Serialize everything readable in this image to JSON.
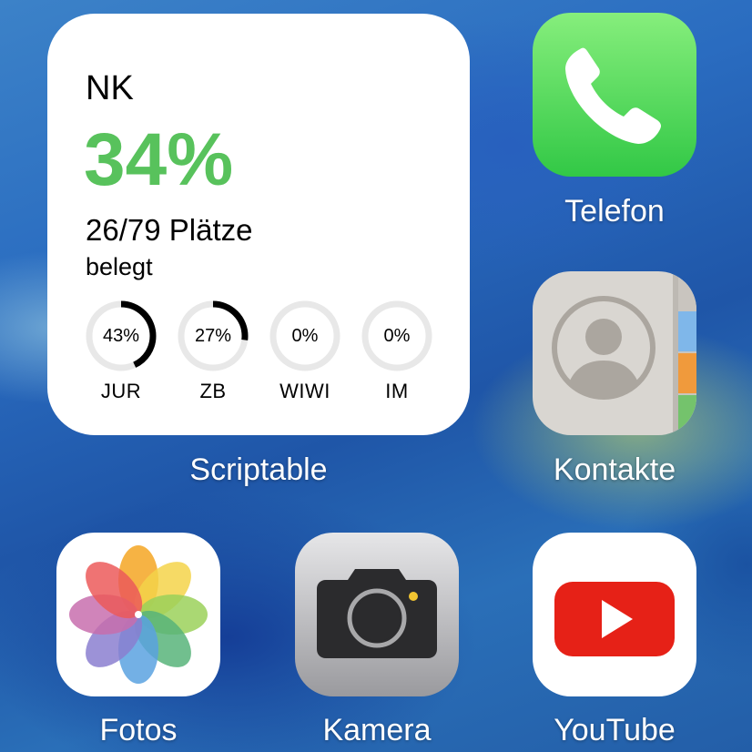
{
  "widget": {
    "title": "NK",
    "percent": "34%",
    "count": "26/79 Plätze",
    "status": "belegt",
    "accent_color": "#58c25c",
    "rings": [
      {
        "value": "43%",
        "fraction": 0.43,
        "label": "JUR"
      },
      {
        "value": "27%",
        "fraction": 0.27,
        "label": "ZB"
      },
      {
        "value": "0%",
        "fraction": 0,
        "label": "WIWI"
      },
      {
        "value": "0%",
        "fraction": 0,
        "label": "IM"
      }
    ],
    "app_label": "Scriptable"
  },
  "apps": {
    "telefon": {
      "label": "Telefon",
      "icon": "phone-icon"
    },
    "kontakte": {
      "label": "Kontakte",
      "icon": "contacts-icon"
    },
    "fotos": {
      "label": "Fotos",
      "icon": "photos-icon"
    },
    "kamera": {
      "label": "Kamera",
      "icon": "camera-icon"
    },
    "youtube": {
      "label": "YouTube",
      "icon": "youtube-icon"
    }
  }
}
